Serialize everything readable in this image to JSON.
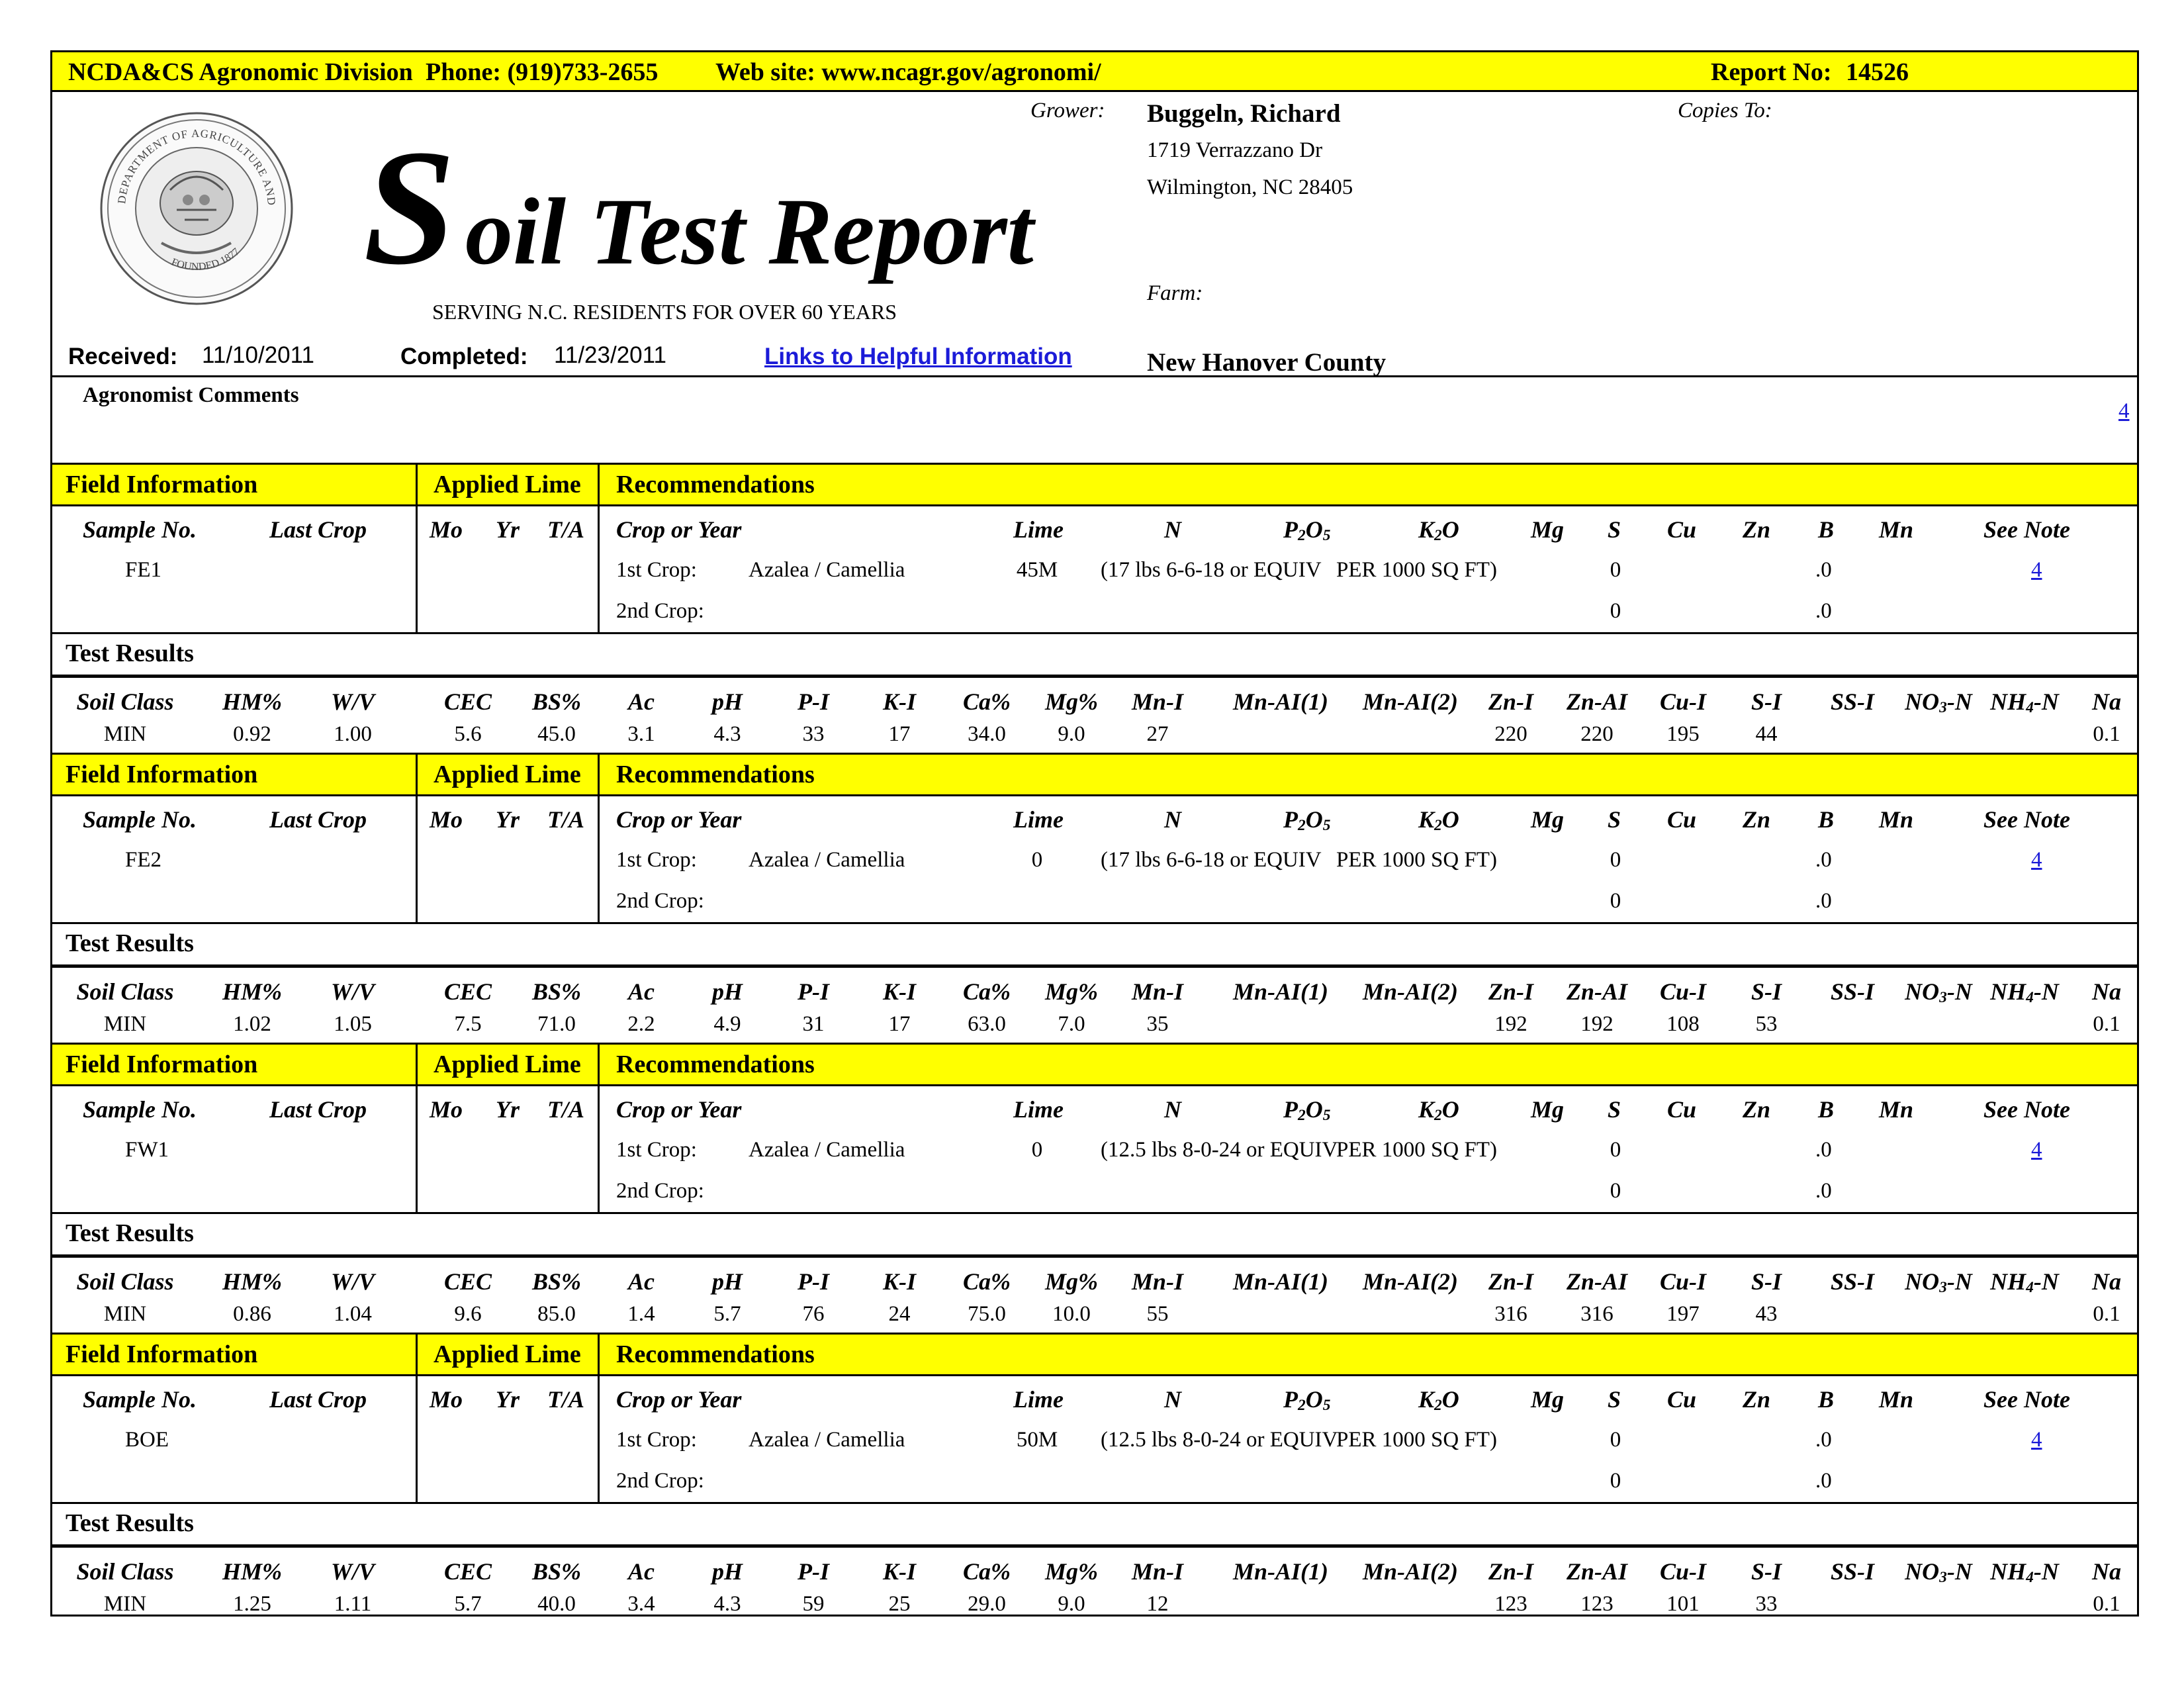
{
  "header": {
    "division": "NCDA&CS Agronomic Division",
    "phone": "Phone: (919)733-2655",
    "website": "Web site: www.ncagr.gov/agronomi/",
    "report_no_label": "Report No:",
    "report_no": "14526"
  },
  "seal": {
    "text_top": "DEPARTMENT OF AGRICULTURE AND CONSUMER SERVICES",
    "text_side": "N.C.",
    "founded": "FOUNDED 1877"
  },
  "title": {
    "s": "S",
    "rest": "oil Test Report",
    "subtitle": "SERVING N.C. RESIDENTS FOR OVER 60 YEARS"
  },
  "dates": {
    "received_label": "Received:",
    "received": "11/10/2011",
    "completed_label": "Completed:",
    "completed": "11/23/2011",
    "links_label": " Links to Helpful Information"
  },
  "grower": {
    "label": "Grower:",
    "name": "Buggeln, Richard",
    "address1": "1719 Verrazzano Dr",
    "address2": "Wilmington, NC  28405",
    "copies_label": "Copies To:",
    "farm_label": "Farm:",
    "county": "New Hanover County"
  },
  "comments": {
    "label": "Agronomist Comments",
    "note_link": "4"
  },
  "labels": {
    "field_information": "Field Information",
    "applied_lime": "Applied Lime",
    "recommendations": "Recommendations",
    "test_results": "Test Results",
    "sample_no": "Sample No.",
    "last_crop": "Last Crop",
    "mo": "Mo",
    "yr": "Yr",
    "ta": "T/A",
    "crop_or_year": "Crop or Year",
    "lime": "Lime",
    "n": "N",
    "p2o5_a": "P",
    "p2o5_b": "2",
    "p2o5_c": "O",
    "p2o5_d": "5",
    "k2o_a": "K",
    "k2o_b": "2",
    "k2o_c": "O",
    "mg": "Mg",
    "s": "S",
    "cu": "Cu",
    "zn": "Zn",
    "b": "B",
    "mn": "Mn",
    "see_note": "See Note",
    "first_crop": "1st Crop:",
    "second_crop": "2nd Crop:",
    "soil_class": "Soil Class",
    "hm": "HM%",
    "wv": "W/V",
    "cec": "CEC",
    "bs": "BS%",
    "ac": "Ac",
    "ph": "pH",
    "pi": "P-I",
    "ki": "K-I",
    "ca": "Ca%",
    "mgp": "Mg%",
    "mni": "Mn-I",
    "mnai1": "Mn-AI(1)",
    "mnai2": "Mn-AI(2)",
    "zni": "Zn-I",
    "znai": "Zn-AI",
    "cui": "Cu-I",
    "si": "S-I",
    "ssi": "SS-I",
    "no3_a": "NO",
    "no3_b": "3",
    "no3_c": "-N",
    "nh4_a": "NH",
    "nh4_b": "4",
    "nh4_c": "-N",
    "na": "Na"
  },
  "samples": [
    {
      "sample_no": "FE1",
      "crop1": "Azalea / Camellia",
      "lime": "45M",
      "fert": "(17 lbs 6-6-18 or EQUIV",
      "per": "PER 1000 SQ FT)",
      "s1": "0",
      "b1": ".0",
      "note": "4",
      "s2": "0",
      "b2": ".0",
      "results": {
        "soil_class": "MIN",
        "hm": "0.92",
        "wv": "1.00",
        "cec": "5.6",
        "bs": "45.0",
        "ac": "3.1",
        "ph": "4.3",
        "pi": "33",
        "ki": "17",
        "ca": "34.0",
        "mg": "9.0",
        "mni": "27",
        "zni": "220",
        "znai": "220",
        "cui": "195",
        "si": "44",
        "na": "0.1"
      }
    },
    {
      "sample_no": "FE2",
      "crop1": "Azalea / Camellia",
      "lime": "0",
      "fert": "(17 lbs 6-6-18 or EQUIV",
      "per": "PER 1000 SQ FT)",
      "s1": "0",
      "b1": ".0",
      "note": "4",
      "s2": "0",
      "b2": ".0",
      "results": {
        "soil_class": "MIN",
        "hm": "1.02",
        "wv": "1.05",
        "cec": "7.5",
        "bs": "71.0",
        "ac": "2.2",
        "ph": "4.9",
        "pi": "31",
        "ki": "17",
        "ca": "63.0",
        "mg": "7.0",
        "mni": "35",
        "zni": "192",
        "znai": "192",
        "cui": "108",
        "si": "53",
        "na": "0.1"
      }
    },
    {
      "sample_no": "FW1",
      "crop1": "Azalea / Camellia",
      "lime": "0",
      "fert": "(12.5 lbs 8-0-24 or EQUIV",
      "per": "PER 1000 SQ FT)",
      "s1": "0",
      "b1": ".0",
      "note": "4",
      "s2": "0",
      "b2": ".0",
      "results": {
        "soil_class": "MIN",
        "hm": "0.86",
        "wv": "1.04",
        "cec": "9.6",
        "bs": "85.0",
        "ac": "1.4",
        "ph": "5.7",
        "pi": "76",
        "ki": "24",
        "ca": "75.0",
        "mg": "10.0",
        "mni": "55",
        "zni": "316",
        "znai": "316",
        "cui": "197",
        "si": "43",
        "na": "0.1"
      }
    },
    {
      "sample_no": "BOE",
      "crop1": "Azalea / Camellia",
      "lime": "50M",
      "fert": "(12.5 lbs 8-0-24 or EQUIV",
      "per": "PER 1000 SQ FT)",
      "s1": "0",
      "b1": ".0",
      "note": "4",
      "s2": "0",
      "b2": ".0",
      "results": {
        "soil_class": "MIN",
        "hm": "1.25",
        "wv": "1.11",
        "cec": "5.7",
        "bs": "40.0",
        "ac": "3.4",
        "ph": "4.3",
        "pi": "59",
        "ki": "25",
        "ca": "29.0",
        "mg": "9.0",
        "mni": "12",
        "zni": "123",
        "znai": "123",
        "cui": "101",
        "si": "33",
        "na": "0.1"
      }
    }
  ]
}
